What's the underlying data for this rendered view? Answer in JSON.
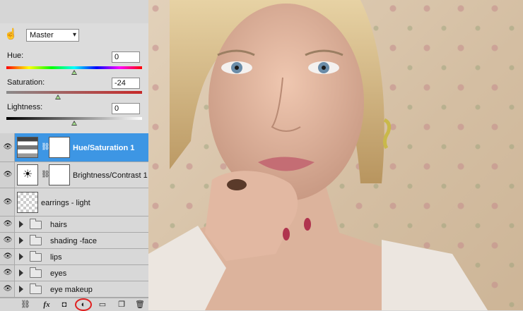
{
  "adjustments": {
    "preset_value": "Master",
    "hue": {
      "label": "Hue:",
      "value": "0",
      "level_percent": 50
    },
    "saturation": {
      "label": "Saturation:",
      "value": "-24",
      "level_percent": 38
    },
    "lightness": {
      "label": "Lightness:",
      "value": "0",
      "level_percent": 50
    }
  },
  "layers": [
    {
      "name": "Hue/Saturation 1",
      "kind": "adjustment",
      "selected": true
    },
    {
      "name": "Brightness/Contrast 1",
      "kind": "adjustment",
      "selected": false
    },
    {
      "name": "earrings - light",
      "kind": "pixel",
      "selected": false
    },
    {
      "name": "hairs",
      "kind": "group"
    },
    {
      "name": "shading -face",
      "kind": "group"
    },
    {
      "name": "lips",
      "kind": "group"
    },
    {
      "name": "eyes",
      "kind": "group"
    },
    {
      "name": "eye makeup",
      "kind": "group"
    }
  ],
  "toolbar": {
    "fx_label": "fx"
  },
  "colors": {
    "selection": "#3d96e4",
    "highlight_circle": "#e02020"
  }
}
